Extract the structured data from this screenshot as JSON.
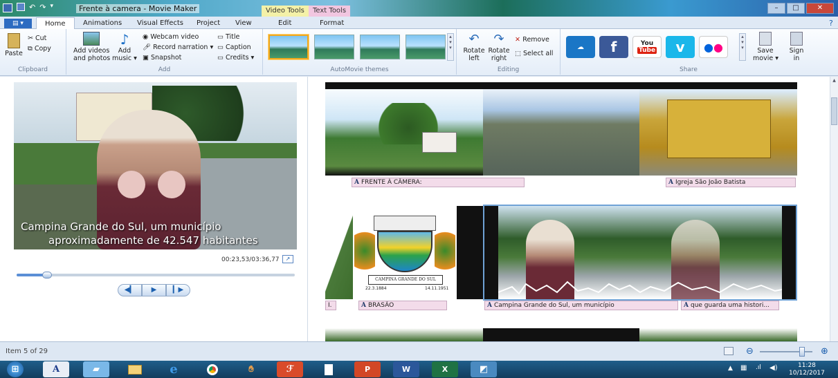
{
  "window": {
    "title": "Frente à camera - Movie Maker",
    "context_tabs": [
      "Video Tools",
      "Text Tools"
    ],
    "buttons": {
      "minimize": "–",
      "maximize": "□",
      "close": "✕"
    }
  },
  "tabs": [
    {
      "label": "Home",
      "active": true
    },
    {
      "label": "Animations"
    },
    {
      "label": "Visual Effects"
    },
    {
      "label": "Project"
    },
    {
      "label": "View"
    },
    {
      "label": "Edit"
    },
    {
      "label": "Format"
    }
  ],
  "ribbon": {
    "clipboard": {
      "paste": "Paste",
      "cut": "Cut",
      "copy": "Copy",
      "group": "Clipboard"
    },
    "add": {
      "add_videos_1": "Add videos",
      "add_videos_2": "and photos",
      "add_music_1": "Add",
      "add_music_2": "music ▾",
      "webcam": "Webcam video",
      "narration": "Record narration ▾",
      "snapshot": "Snapshot",
      "title": "Title",
      "caption": "Caption",
      "credits": "Credits ▾",
      "group": "Add"
    },
    "themes": {
      "group": "AutoMovie themes"
    },
    "editing": {
      "rotate_left_1": "Rotate",
      "rotate_left_2": "left",
      "rotate_right_1": "Rotate",
      "rotate_right_2": "right",
      "remove": "Remove",
      "select_all": "Select all",
      "group": "Editing"
    },
    "share": {
      "youtube_1": "You",
      "youtube_2": "Tube",
      "save_movie_1": "Save",
      "save_movie_2": "movie ▾",
      "sign_in_1": "Sign",
      "sign_in_2": "in",
      "group": "Share"
    }
  },
  "preview": {
    "caption_line1": "Campina Grande do Sul, um município",
    "caption_line2": "aproximadamente de 42.547 habitantes",
    "timecode": "00:23,53/03:36,77",
    "seek_progress": 0.11
  },
  "storyboard": {
    "row1_captions": [
      "FRENTE À CÂMERA:",
      "Igreja São João Batista"
    ],
    "row2_captions": [
      "I.",
      "BRASÃO",
      "Campina Grande do Sul, um município",
      "que guarda uma histori..."
    ],
    "emblem_text_1": "CAMPINA GRANDE DO SUL",
    "emblem_date_1": "22.3.1884",
    "emblem_date_2": "14.11.1951",
    "caption_glyph": "A"
  },
  "status": {
    "item": "Item 5 of 29",
    "zoom_minus": "⊖",
    "zoom_plus": "⊕",
    "zoom_level": 0.8
  },
  "taskbar": {
    "apps": [
      "A",
      "P",
      "W",
      "X"
    ],
    "time": "11:28",
    "date": "10/12/2017"
  }
}
